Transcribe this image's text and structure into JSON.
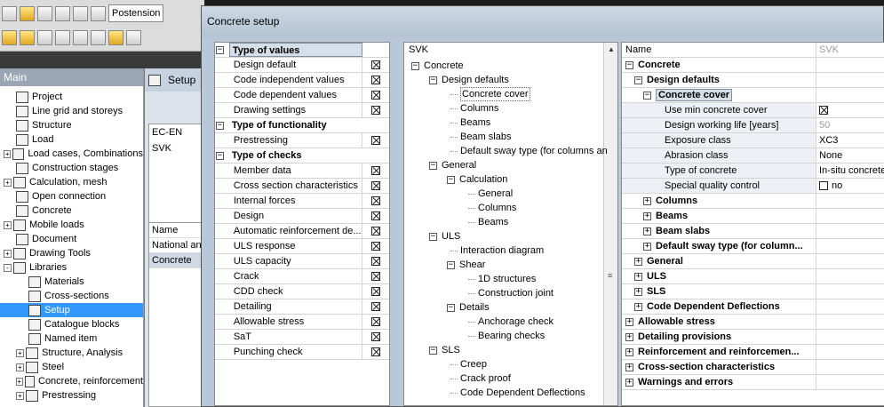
{
  "app": {
    "toolbar_combo": "Postension",
    "main_panel_title": "Main",
    "main_tree": [
      {
        "label": "Project",
        "level": 1,
        "expander": "",
        "selected": false
      },
      {
        "label": "Line grid and storeys",
        "level": 1,
        "expander": "",
        "selected": false
      },
      {
        "label": "Structure",
        "level": 1,
        "expander": "",
        "selected": false
      },
      {
        "label": "Load",
        "level": 1,
        "expander": "",
        "selected": false
      },
      {
        "label": "Load cases, Combinations",
        "level": 0,
        "expander": "+",
        "selected": false
      },
      {
        "label": "Construction stages",
        "level": 1,
        "expander": "",
        "selected": false
      },
      {
        "label": "Calculation, mesh",
        "level": 0,
        "expander": "+",
        "selected": false
      },
      {
        "label": "Open connection",
        "level": 1,
        "expander": "",
        "selected": false
      },
      {
        "label": "Concrete",
        "level": 1,
        "expander": "",
        "selected": false
      },
      {
        "label": "Mobile loads",
        "level": 0,
        "expander": "+",
        "selected": false
      },
      {
        "label": "Document",
        "level": 1,
        "expander": "",
        "selected": false
      },
      {
        "label": "Drawing Tools",
        "level": 0,
        "expander": "+",
        "selected": false
      },
      {
        "label": "Libraries",
        "level": 0,
        "expander": "-",
        "selected": false
      },
      {
        "label": "Materials",
        "level": 2,
        "expander": "",
        "selected": false
      },
      {
        "label": "Cross-sections",
        "level": 2,
        "expander": "",
        "selected": false
      },
      {
        "label": "Setup",
        "level": 2,
        "expander": "",
        "selected": true
      },
      {
        "label": "Catalogue blocks",
        "level": 2,
        "expander": "",
        "selected": false
      },
      {
        "label": "Named item",
        "level": 2,
        "expander": "",
        "selected": false
      },
      {
        "label": "Structure, Analysis",
        "level": 1,
        "expander": "+",
        "selected": false
      },
      {
        "label": "Steel",
        "level": 1,
        "expander": "+",
        "selected": false
      },
      {
        "label": "Concrete, reinforcement",
        "level": 1,
        "expander": "+",
        "selected": false
      },
      {
        "label": "Prestressing",
        "level": 1,
        "expander": "+",
        "selected": false
      }
    ],
    "setup_window": {
      "title": "Setup",
      "list": [
        "EC-EN",
        "SVK"
      ],
      "grid": [
        "Name",
        "National an",
        "Concrete"
      ]
    }
  },
  "dialog": {
    "title": "Concrete setup",
    "type_values": [
      {
        "label": "Type of values",
        "group": true,
        "first": true
      },
      {
        "label": "Design default",
        "checked": true
      },
      {
        "label": "Code independent values",
        "checked": true
      },
      {
        "label": "Code dependent values",
        "checked": true
      },
      {
        "label": "Drawing settings",
        "checked": true
      },
      {
        "label": "Type of functionality",
        "group": true
      },
      {
        "label": "Prestressing",
        "checked": true
      },
      {
        "label": "Type of checks",
        "group": true
      },
      {
        "label": "Member data",
        "checked": true
      },
      {
        "label": "Cross section characteristics",
        "checked": true
      },
      {
        "label": "Internal forces",
        "checked": true
      },
      {
        "label": "Design",
        "checked": true
      },
      {
        "label": "Automatic reinforcement de...",
        "checked": true
      },
      {
        "label": "ULS response",
        "checked": true
      },
      {
        "label": "ULS capacity",
        "checked": true
      },
      {
        "label": "Crack",
        "checked": true
      },
      {
        "label": "CDD check",
        "checked": true
      },
      {
        "label": "Detailing",
        "checked": true
      },
      {
        "label": "Allowable stress",
        "checked": true
      },
      {
        "label": "SaT",
        "checked": true
      },
      {
        "label": "Punching check",
        "checked": true
      }
    ],
    "tree_root": "SVK",
    "tree": [
      {
        "label": "Concrete",
        "level": 0,
        "expander": "-"
      },
      {
        "label": "Design defaults",
        "level": 1,
        "expander": "-"
      },
      {
        "label": "Concrete cover",
        "level": 2,
        "expander": "",
        "selected": true
      },
      {
        "label": "Columns",
        "level": 2,
        "expander": ""
      },
      {
        "label": "Beams",
        "level": 2,
        "expander": ""
      },
      {
        "label": "Beam slabs",
        "level": 2,
        "expander": ""
      },
      {
        "label": "Default sway type (for columns an",
        "level": 2,
        "expander": ""
      },
      {
        "label": "General",
        "level": 1,
        "expander": "-"
      },
      {
        "label": "Calculation",
        "level": 2,
        "expander": "-"
      },
      {
        "label": "General",
        "level": 3,
        "expander": ""
      },
      {
        "label": "Columns",
        "level": 3,
        "expander": ""
      },
      {
        "label": "Beams",
        "level": 3,
        "expander": ""
      },
      {
        "label": "ULS",
        "level": 1,
        "expander": "-"
      },
      {
        "label": "Interaction diagram",
        "level": 2,
        "expander": ""
      },
      {
        "label": "Shear",
        "level": 2,
        "expander": "-"
      },
      {
        "label": "1D structures",
        "level": 3,
        "expander": ""
      },
      {
        "label": "Construction joint",
        "level": 3,
        "expander": ""
      },
      {
        "label": "Details",
        "level": 2,
        "expander": "-"
      },
      {
        "label": "Anchorage check",
        "level": 3,
        "expander": ""
      },
      {
        "label": "Bearing checks",
        "level": 3,
        "expander": ""
      },
      {
        "label": "SLS",
        "level": 1,
        "expander": "-"
      },
      {
        "label": "Creep",
        "level": 2,
        "expander": ""
      },
      {
        "label": "Crack proof",
        "level": 2,
        "expander": ""
      },
      {
        "label": "Code Dependent Deflections",
        "level": 2,
        "expander": ""
      }
    ],
    "props_header": {
      "name": "Name",
      "value": "SVK"
    },
    "props": [
      {
        "label": "Concrete",
        "level": 0,
        "expander": "-",
        "bold": true,
        "value": ""
      },
      {
        "label": "Design defaults",
        "level": 1,
        "expander": "-",
        "bold": true,
        "value": ""
      },
      {
        "label": "Concrete cover",
        "level": 2,
        "expander": "-",
        "bold": true,
        "section": true,
        "value": ""
      },
      {
        "label": "Use min concrete cover",
        "level": 3,
        "shade": true,
        "check": true,
        "value": ""
      },
      {
        "label": "Design working life [years]",
        "level": 3,
        "shade": true,
        "value": "50",
        "gray": true
      },
      {
        "label": "Exposure class",
        "level": 3,
        "shade": true,
        "value": "XC3"
      },
      {
        "label": "Abrasion class",
        "level": 3,
        "shade": true,
        "value": "None"
      },
      {
        "label": "Type of concrete",
        "level": 3,
        "shade": true,
        "value": "In-situ concrete"
      },
      {
        "label": "Special quality control",
        "level": 3,
        "shade": true,
        "check": false,
        "value": "no"
      },
      {
        "label": "Columns",
        "level": 2,
        "expander": "+",
        "bold": true,
        "value": ""
      },
      {
        "label": "Beams",
        "level": 2,
        "expander": "+",
        "bold": true,
        "value": ""
      },
      {
        "label": "Beam slabs",
        "level": 2,
        "expander": "+",
        "bold": true,
        "value": ""
      },
      {
        "label": "Default sway type (for column...",
        "level": 2,
        "expander": "+",
        "bold": true,
        "value": ""
      },
      {
        "label": "General",
        "level": 1,
        "expander": "+",
        "bold": true,
        "value": ""
      },
      {
        "label": "ULS",
        "level": 1,
        "expander": "+",
        "bold": true,
        "value": ""
      },
      {
        "label": "SLS",
        "level": 1,
        "expander": "+",
        "bold": true,
        "value": ""
      },
      {
        "label": "Code Dependent Deflections",
        "level": 1,
        "expander": "+",
        "bold": true,
        "value": ""
      },
      {
        "label": "Allowable stress",
        "level": 0,
        "expander": "+",
        "bold": true,
        "value": ""
      },
      {
        "label": "Detailing provisions",
        "level": 0,
        "expander": "+",
        "bold": true,
        "value": ""
      },
      {
        "label": "Reinforcement and reinforcemen...",
        "level": 0,
        "expander": "+",
        "bold": true,
        "value": ""
      },
      {
        "label": "Cross-section characteristics",
        "level": 0,
        "expander": "+",
        "bold": true,
        "value": ""
      },
      {
        "label": "Warnings and errors",
        "level": 0,
        "expander": "+",
        "bold": true,
        "value": ""
      }
    ]
  }
}
